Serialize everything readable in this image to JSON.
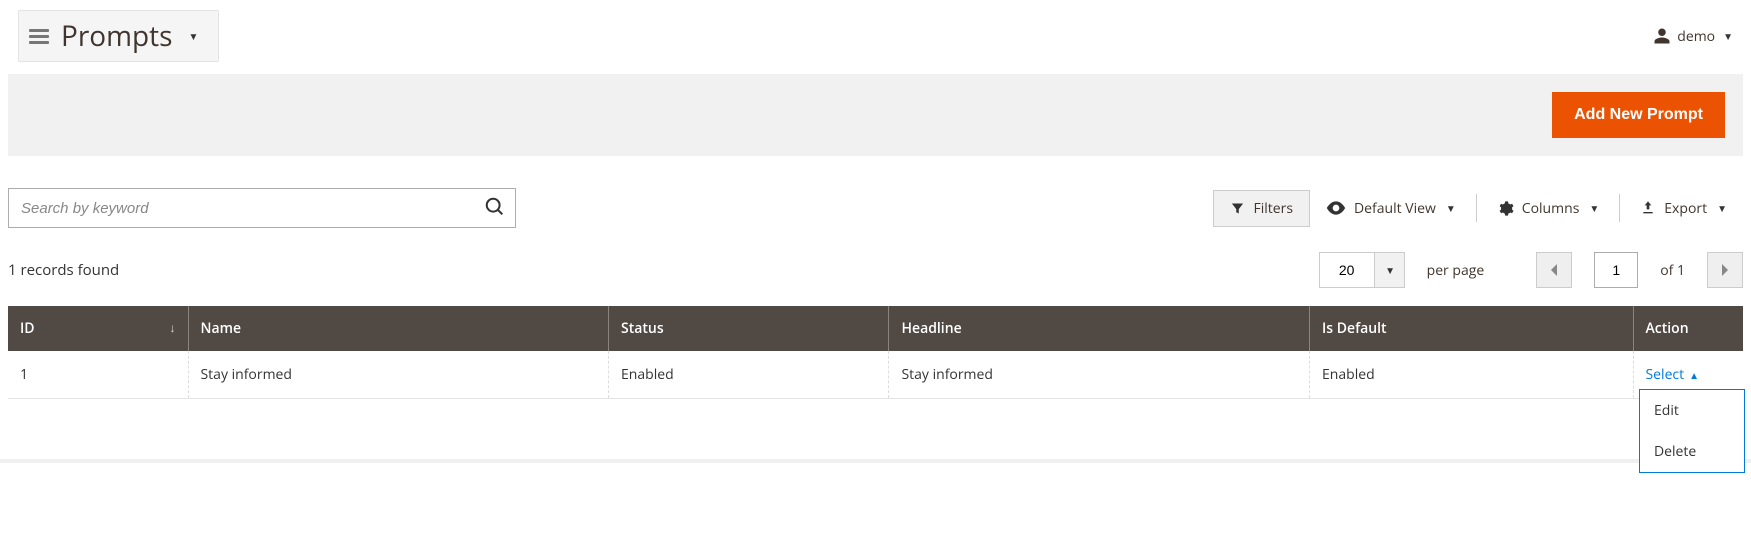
{
  "header": {
    "title": "Prompts",
    "user_label": "demo"
  },
  "actions": {
    "add_new": "Add New Prompt"
  },
  "search": {
    "placeholder": "Search by keyword"
  },
  "toolbar": {
    "filters": "Filters",
    "default_view": "Default View",
    "columns": "Columns",
    "export": "Export"
  },
  "pager": {
    "records_found": "1 records found",
    "page_size": "20",
    "per_page": "per page",
    "current_page": "1",
    "of_pages": "of 1"
  },
  "grid": {
    "columns": {
      "id": "ID",
      "name": "Name",
      "status": "Status",
      "headline": "Headline",
      "is_default": "Is Default",
      "action": "Action"
    },
    "rows": [
      {
        "id": "1",
        "name": "Stay informed",
        "status": "Enabled",
        "headline": "Stay informed",
        "is_default": "Enabled",
        "action_label": "Select"
      }
    ],
    "action_menu": {
      "edit": "Edit",
      "delete": "Delete"
    }
  }
}
